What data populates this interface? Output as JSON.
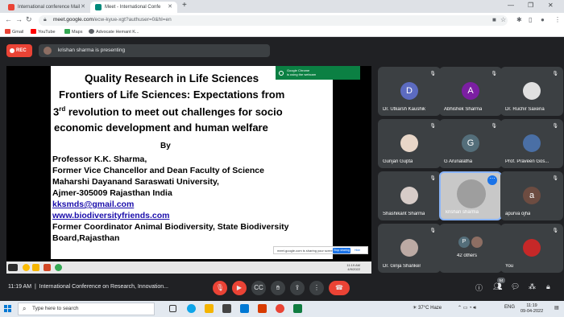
{
  "browser": {
    "tabs": [
      {
        "label": "International conference Mail",
        "active": false,
        "icon_color": "#ea4335"
      },
      {
        "label": "Meet - International Confe",
        "active": true,
        "icon_color": "#00897b"
      }
    ],
    "url_host": "meet.google.com",
    "url_path": "/ecw-kyue-xgt?authuser=0&hl=en",
    "bookmarks": [
      {
        "label": "Gmail",
        "color": "#ea4335"
      },
      {
        "label": "YouTube",
        "color": "#ff0000"
      },
      {
        "label": "Maps",
        "color": "#34a853"
      },
      {
        "label": "Advocate Hemant K...",
        "color": "#5f6368"
      }
    ]
  },
  "meet": {
    "rec_label": "REC",
    "presenting_text": "krishan sharma is presenting",
    "toast_line1": "Google Chrome",
    "toast_line2": "is using the webcam",
    "slide": {
      "line1": "Quality Research in Life Sciences",
      "line2": "Frontiers of Life Sciences: Expectations from",
      "line3_num": "3",
      "line3_sup": "rd",
      "line3_rest": " revolution to meet out challenges for socio",
      "line4": "economic development and human welfare",
      "by": "By",
      "author": [
        "Professor K.K. Sharma,",
        "Former Vice Chancellor and Dean Faculty of Science",
        "Maharshi Dayanand Saraswati University,",
        "Ajmer-305009 Rajasthan India"
      ],
      "email": "kksmds@gmail.com",
      "website": "www.biodiversityfriends.com",
      "footer1": "Former Coordinator Animal Biodiversity, State Biodiversity",
      "footer2": "Board,Rajasthan",
      "share_text": "meet.google.com is sharing your screen.",
      "stop_label": "Stop sharing",
      "hide_label": "Hide",
      "mini_time": "11:19 AM",
      "mini_date": "4/9/2022"
    },
    "participants": [
      {
        "name": "Dr. Utkarsh Kaushik",
        "initial": "D",
        "color": "#5c6bc0",
        "photo": false
      },
      {
        "name": "Abhishek Sharma",
        "initial": "A",
        "color": "#7b1fa2",
        "photo": false
      },
      {
        "name": "Dr. Ruchir Saxena",
        "initial": "",
        "color": "#e0e0e0",
        "photo": true
      },
      {
        "name": "Gunjan Gupta",
        "initial": "",
        "color": "#e8d6c8",
        "photo": true
      },
      {
        "name": "G Arunalatha",
        "initial": "G",
        "color": "#546e7a",
        "photo": false
      },
      {
        "name": "Prof. Praveen Gos...",
        "initial": "",
        "color": "#4a6fa5",
        "photo": true
      },
      {
        "name": "Shashikant Sharma",
        "initial": "",
        "color": "#d7ccc8",
        "photo": true
      },
      {
        "name": "krishan sharma",
        "initial": "",
        "color": "#9e9e9e",
        "photo": true
      },
      {
        "name": "apurva ojha",
        "initial": "a",
        "color": "#6d4c41",
        "photo": false
      },
      {
        "name": "Dr. Girija Shanker",
        "initial": "",
        "color": "#bcaaa4",
        "photo": true
      },
      {
        "name": "42 others",
        "initial": "P",
        "color": "#546e7a",
        "photo": false
      },
      {
        "name": "You",
        "initial": "",
        "color": "#c62828",
        "photo": true
      }
    ],
    "clock": "11:19 AM",
    "meeting_title": "International Conference on Research, Innovation...",
    "participant_count": "54"
  },
  "taskbar": {
    "search_placeholder": "Type here to search",
    "weather": "37°C Haze",
    "lang": "ENG",
    "time": "11:19",
    "date": "09-04-2022"
  }
}
